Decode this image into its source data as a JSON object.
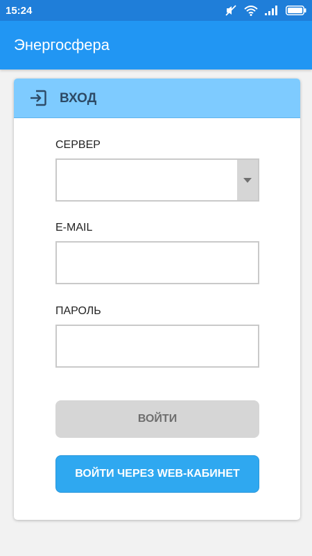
{
  "statusbar": {
    "time": "15:24",
    "icons": [
      "mute-icon",
      "wifi-icon",
      "signal-icon",
      "battery-icon"
    ]
  },
  "appbar": {
    "title": "Энергосфера"
  },
  "card": {
    "header_icon": "login-icon",
    "header_title": "ВХОД",
    "server_label": "СЕРВЕР",
    "server_value": "",
    "email_label": "E-MAIL",
    "email_value": "",
    "password_label": "ПАРОЛЬ",
    "password_value": "",
    "login_button": "ВОЙТИ",
    "web_login_button": "ВОЙТИ ЧЕРЕЗ WEB-КАБИНЕТ"
  },
  "colors": {
    "statusbar": "#1f7ed9",
    "appbar": "#2196f3",
    "card_header": "#7ecbff",
    "login_button_disabled": "#d6d6d6",
    "web_button": "#2fa8f0"
  }
}
